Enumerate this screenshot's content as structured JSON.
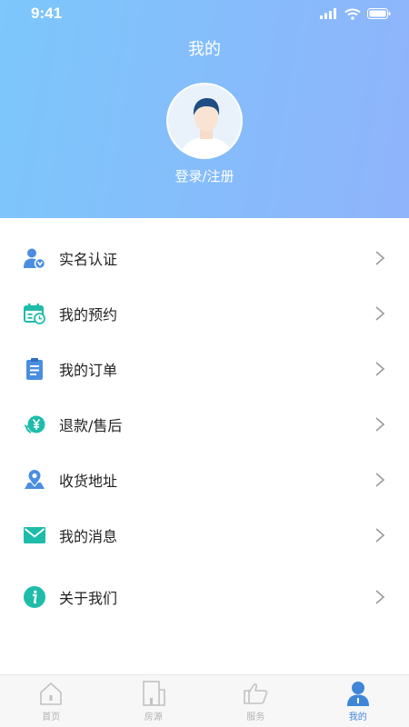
{
  "status_bar": {
    "time": "9:41"
  },
  "header": {
    "title": "我的",
    "login_text": "登录/注册"
  },
  "menu": [
    {
      "label": "实名认证",
      "icon": "user-verify-icon",
      "color": "#4a8ee0"
    },
    {
      "label": "我的预约",
      "icon": "calendar-clock-icon",
      "color": "#1fbcaa"
    },
    {
      "label": "我的订单",
      "icon": "clipboard-icon",
      "color": "#4a8ee0"
    },
    {
      "label": "退款/售后",
      "icon": "refund-yen-icon",
      "color": "#1fbcaa"
    },
    {
      "label": "收货地址",
      "icon": "location-pin-icon",
      "color": "#4a8ee0"
    },
    {
      "label": "我的消息",
      "icon": "envelope-icon",
      "color": "#1fbcaa"
    },
    {
      "label": "关于我们",
      "icon": "info-icon",
      "color": "#1fbcaa"
    }
  ],
  "tabbar": [
    {
      "label": "首页",
      "icon": "home-icon",
      "active": false
    },
    {
      "label": "房源",
      "icon": "building-icon",
      "active": false
    },
    {
      "label": "服务",
      "icon": "service-hand-icon",
      "active": false
    },
    {
      "label": "我的",
      "icon": "profile-icon",
      "active": true
    }
  ],
  "colors": {
    "header_start": "#7cc7fb",
    "header_end": "#8fb4fb",
    "accent_blue": "#4a8ee0",
    "accent_teal": "#1fbcaa",
    "tab_active": "#3f86d8"
  }
}
